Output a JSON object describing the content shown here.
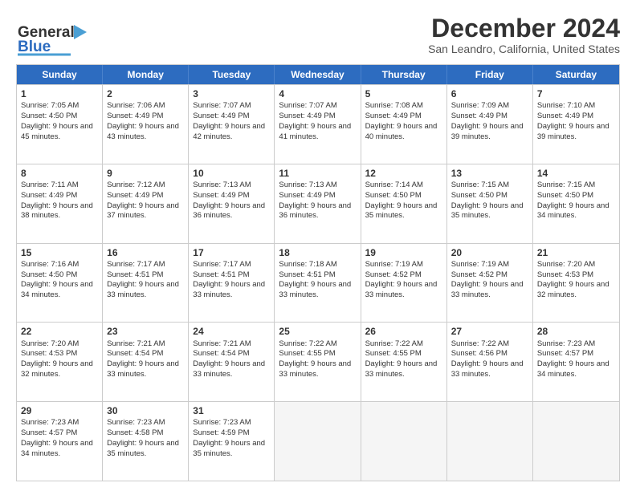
{
  "header": {
    "logo_text_general": "General",
    "logo_text_blue": "Blue",
    "main_title": "December 2024",
    "subtitle": "San Leandro, California, United States"
  },
  "calendar": {
    "days_of_week": [
      "Sunday",
      "Monday",
      "Tuesday",
      "Wednesday",
      "Thursday",
      "Friday",
      "Saturday"
    ],
    "weeks": [
      [
        {
          "day": "",
          "empty": true
        },
        {
          "day": "",
          "empty": true
        },
        {
          "day": "",
          "empty": true
        },
        {
          "day": "",
          "empty": true
        },
        {
          "day": "",
          "empty": true
        },
        {
          "day": "",
          "empty": true
        },
        {
          "day": "",
          "empty": true
        }
      ],
      [
        {
          "day": "1",
          "sunrise": "7:05 AM",
          "sunset": "4:50 PM",
          "daylight": "9 hours and 45 minutes."
        },
        {
          "day": "2",
          "sunrise": "7:06 AM",
          "sunset": "4:49 PM",
          "daylight": "9 hours and 43 minutes."
        },
        {
          "day": "3",
          "sunrise": "7:07 AM",
          "sunset": "4:49 PM",
          "daylight": "9 hours and 42 minutes."
        },
        {
          "day": "4",
          "sunrise": "7:07 AM",
          "sunset": "4:49 PM",
          "daylight": "9 hours and 41 minutes."
        },
        {
          "day": "5",
          "sunrise": "7:08 AM",
          "sunset": "4:49 PM",
          "daylight": "9 hours and 40 minutes."
        },
        {
          "day": "6",
          "sunrise": "7:09 AM",
          "sunset": "4:49 PM",
          "daylight": "9 hours and 39 minutes."
        },
        {
          "day": "7",
          "sunrise": "7:10 AM",
          "sunset": "4:49 PM",
          "daylight": "9 hours and 39 minutes."
        }
      ],
      [
        {
          "day": "8",
          "sunrise": "7:11 AM",
          "sunset": "4:49 PM",
          "daylight": "9 hours and 38 minutes."
        },
        {
          "day": "9",
          "sunrise": "7:12 AM",
          "sunset": "4:49 PM",
          "daylight": "9 hours and 37 minutes."
        },
        {
          "day": "10",
          "sunrise": "7:13 AM",
          "sunset": "4:49 PM",
          "daylight": "9 hours and 36 minutes."
        },
        {
          "day": "11",
          "sunrise": "7:13 AM",
          "sunset": "4:49 PM",
          "daylight": "9 hours and 36 minutes."
        },
        {
          "day": "12",
          "sunrise": "7:14 AM",
          "sunset": "4:50 PM",
          "daylight": "9 hours and 35 minutes."
        },
        {
          "day": "13",
          "sunrise": "7:15 AM",
          "sunset": "4:50 PM",
          "daylight": "9 hours and 35 minutes."
        },
        {
          "day": "14",
          "sunrise": "7:15 AM",
          "sunset": "4:50 PM",
          "daylight": "9 hours and 34 minutes."
        }
      ],
      [
        {
          "day": "15",
          "sunrise": "7:16 AM",
          "sunset": "4:50 PM",
          "daylight": "9 hours and 34 minutes."
        },
        {
          "day": "16",
          "sunrise": "7:17 AM",
          "sunset": "4:51 PM",
          "daylight": "9 hours and 33 minutes."
        },
        {
          "day": "17",
          "sunrise": "7:17 AM",
          "sunset": "4:51 PM",
          "daylight": "9 hours and 33 minutes."
        },
        {
          "day": "18",
          "sunrise": "7:18 AM",
          "sunset": "4:51 PM",
          "daylight": "9 hours and 33 minutes."
        },
        {
          "day": "19",
          "sunrise": "7:19 AM",
          "sunset": "4:52 PM",
          "daylight": "9 hours and 33 minutes."
        },
        {
          "day": "20",
          "sunrise": "7:19 AM",
          "sunset": "4:52 PM",
          "daylight": "9 hours and 33 minutes."
        },
        {
          "day": "21",
          "sunrise": "7:20 AM",
          "sunset": "4:53 PM",
          "daylight": "9 hours and 32 minutes."
        }
      ],
      [
        {
          "day": "22",
          "sunrise": "7:20 AM",
          "sunset": "4:53 PM",
          "daylight": "9 hours and 32 minutes."
        },
        {
          "day": "23",
          "sunrise": "7:21 AM",
          "sunset": "4:54 PM",
          "daylight": "9 hours and 33 minutes."
        },
        {
          "day": "24",
          "sunrise": "7:21 AM",
          "sunset": "4:54 PM",
          "daylight": "9 hours and 33 minutes."
        },
        {
          "day": "25",
          "sunrise": "7:22 AM",
          "sunset": "4:55 PM",
          "daylight": "9 hours and 33 minutes."
        },
        {
          "day": "26",
          "sunrise": "7:22 AM",
          "sunset": "4:55 PM",
          "daylight": "9 hours and 33 minutes."
        },
        {
          "day": "27",
          "sunrise": "7:22 AM",
          "sunset": "4:56 PM",
          "daylight": "9 hours and 33 minutes."
        },
        {
          "day": "28",
          "sunrise": "7:23 AM",
          "sunset": "4:57 PM",
          "daylight": "9 hours and 34 minutes."
        }
      ],
      [
        {
          "day": "29",
          "sunrise": "7:23 AM",
          "sunset": "4:57 PM",
          "daylight": "9 hours and 34 minutes."
        },
        {
          "day": "30",
          "sunrise": "7:23 AM",
          "sunset": "4:58 PM",
          "daylight": "9 hours and 35 minutes."
        },
        {
          "day": "31",
          "sunrise": "7:23 AM",
          "sunset": "4:59 PM",
          "daylight": "9 hours and 35 minutes."
        },
        {
          "day": "",
          "empty": true
        },
        {
          "day": "",
          "empty": true
        },
        {
          "day": "",
          "empty": true
        },
        {
          "day": "",
          "empty": true
        }
      ]
    ]
  }
}
